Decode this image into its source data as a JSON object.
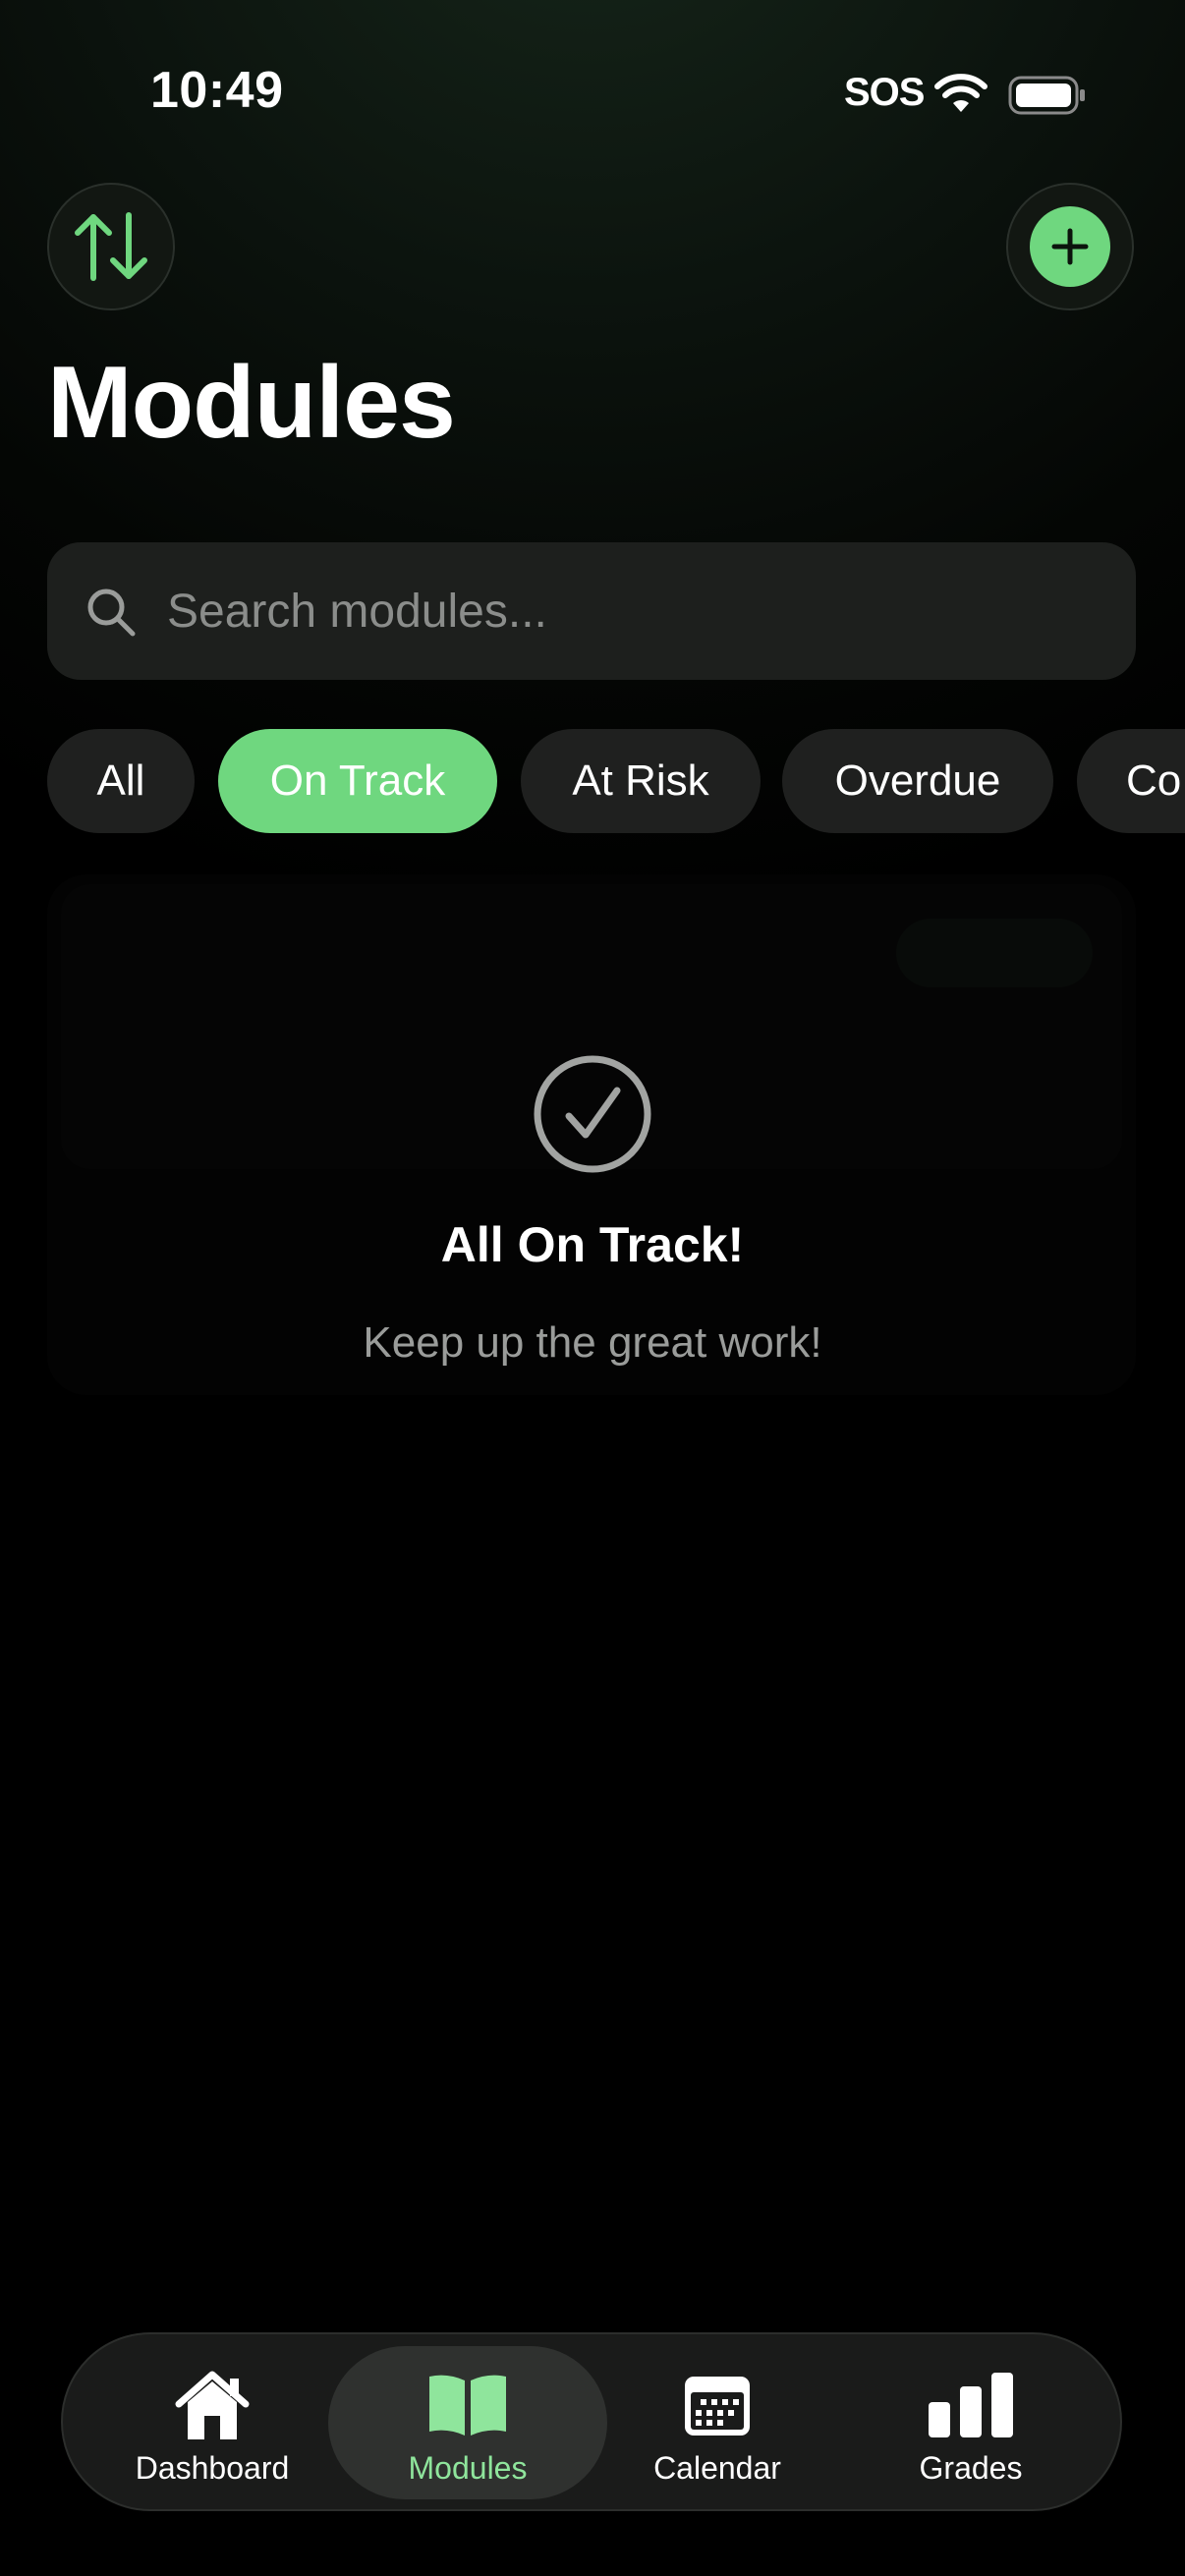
{
  "status_bar": {
    "time": "10:49",
    "sos": "SOS"
  },
  "header": {
    "title": "Modules",
    "sort_icon": "arrow-up-down-icon",
    "add_icon": "plus-icon"
  },
  "search": {
    "placeholder": "Search modules...",
    "value": ""
  },
  "filters": [
    {
      "label": "All",
      "active": false
    },
    {
      "label": "On Track",
      "active": true
    },
    {
      "label": "At Risk",
      "active": false
    },
    {
      "label": "Overdue",
      "active": false
    },
    {
      "label": "Co",
      "active": false
    }
  ],
  "empty_state": {
    "icon": "checkmark-circle-icon",
    "title": "All On Track!",
    "subtitle": "Keep up the great work!"
  },
  "tabs": [
    {
      "label": "Dashboard",
      "icon": "house-icon",
      "active": false
    },
    {
      "label": "Modules",
      "icon": "book-icon",
      "active": true
    },
    {
      "label": "Calendar",
      "icon": "calendar-icon",
      "active": false
    },
    {
      "label": "Grades",
      "icon": "bar-chart-icon",
      "active": false
    }
  ],
  "colors": {
    "accent": "#6fd77f",
    "accent_text": "#8fe59c",
    "background": "#000000",
    "surface": "#1d1f1d"
  }
}
